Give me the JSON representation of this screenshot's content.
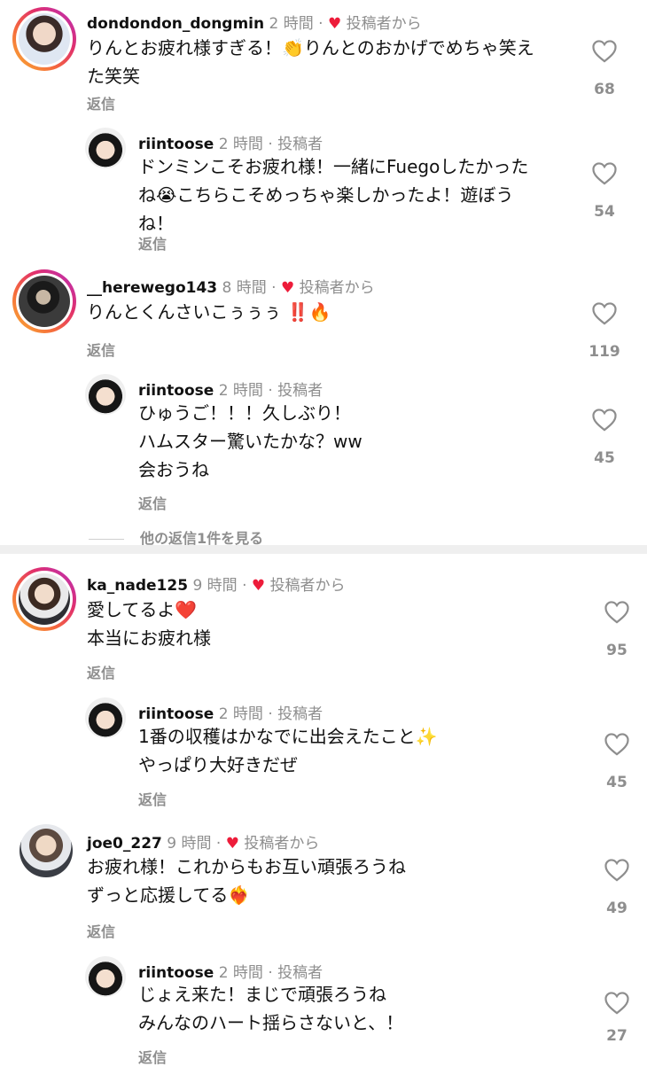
{
  "comments": [
    {
      "username": "dondondon_dongmin",
      "time": "2 時間",
      "sep": "·",
      "liked_by_author": "投稿者から",
      "text_lines": [
        "りんとお疲れ様すぎる！👏りんとのおかげでめちゃ笑え",
        "た笑笑"
      ],
      "reply_label": "返信",
      "likes": "68"
    },
    {
      "username": "riintoose",
      "time": "2 時間",
      "sep": "·",
      "author_badge": "投稿者",
      "text_lines": [
        "ドンミンこそお疲れ様！一緒にFuegoしたかった",
        "ね😭こちらこそめっちゃ楽しかったよ！遊ぼう",
        "ね！"
      ],
      "reply_label": "返信",
      "likes": "54"
    },
    {
      "username": "__herewego143",
      "time": "8 時間",
      "sep": "·",
      "liked_by_author": "投稿者から",
      "text_lines": [
        "りんとくんさいこぅぅぅ ‼️🔥"
      ],
      "reply_label": "返信",
      "likes": "119"
    },
    {
      "username": "riintoose",
      "time": "2 時間",
      "sep": "·",
      "author_badge": "投稿者",
      "text_lines": [
        "ひゅうご！！！久しぶり！",
        "ハムスター驚いたかな？ww",
        "会おうね"
      ],
      "reply_label": "返信",
      "likes": "45"
    },
    {
      "username": "ka_nade125",
      "time": "9 時間",
      "sep": "·",
      "liked_by_author": "投稿者から",
      "text_lines": [
        "愛してるよ❤️",
        "本当にお疲れ様"
      ],
      "reply_label": "返信",
      "likes": "95"
    },
    {
      "username": "riintoose",
      "time": "2 時間",
      "sep": "·",
      "author_badge": "投稿者",
      "text_lines": [
        "1番の収穫はかなでに出会えたこと✨",
        "やっぱり大好きだぜ"
      ],
      "reply_label": "返信",
      "likes": "45"
    },
    {
      "username": "joe0_227",
      "time": "9 時間",
      "sep": "·",
      "liked_by_author": "投稿者から",
      "text_lines": [
        "お疲れ様！これからもお互い頑張ろうね",
        "ずっと応援してる❤️‍🔥"
      ],
      "reply_label": "返信",
      "likes": "49"
    },
    {
      "username": "riintoose",
      "time": "2 時間",
      "sep": "·",
      "author_badge": "投稿者",
      "text_lines": [
        "じょえ来た！まじで頑張ろうね",
        "みんなのハート揺らさないと、！"
      ],
      "reply_label": "返信",
      "likes": "27"
    }
  ],
  "view_more_replies": "他の返信1件を見る",
  "colors": {
    "heart_red": "#ed1c3a",
    "muted": "#8e8e8e"
  }
}
